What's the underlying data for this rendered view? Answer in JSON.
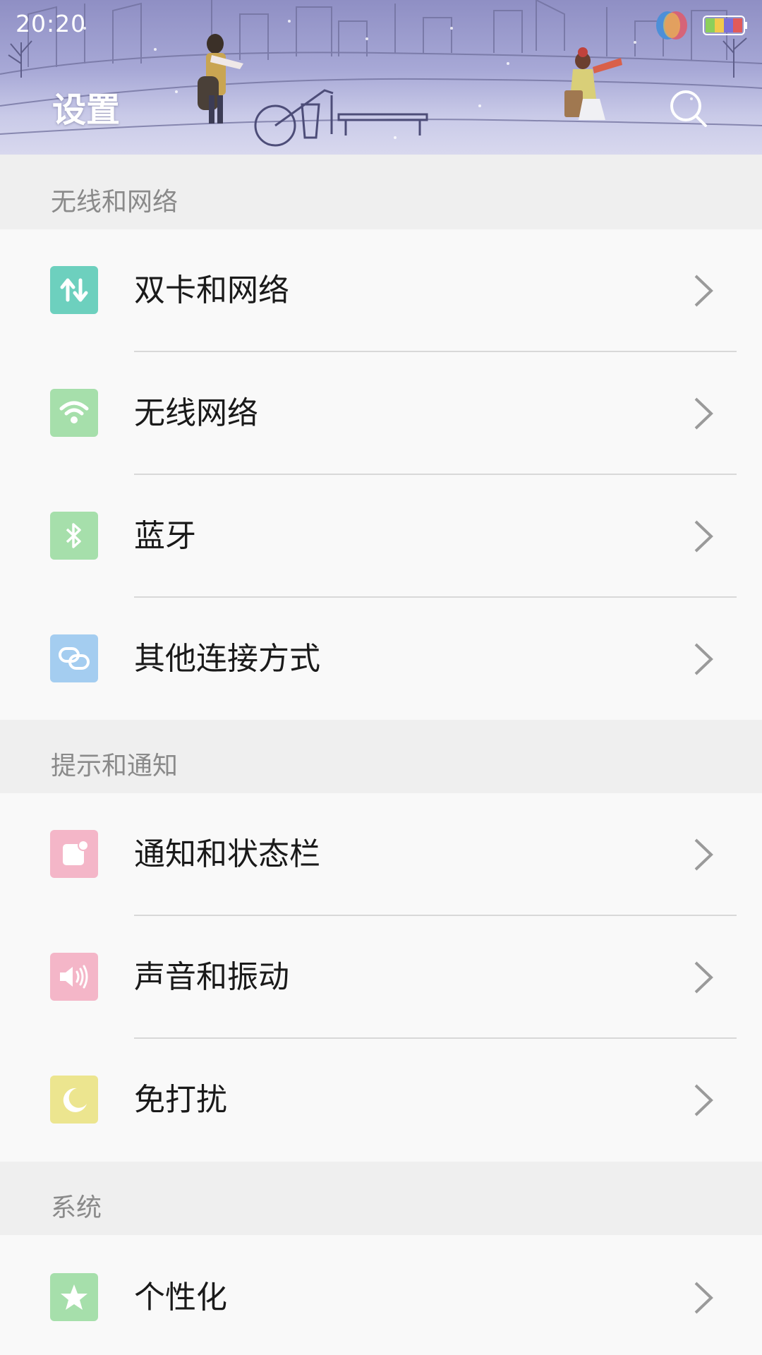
{
  "status_bar": {
    "time": "20:20"
  },
  "header": {
    "title": "设置"
  },
  "sections": [
    {
      "title": "无线和网络",
      "items": [
        {
          "label": "双卡和网络",
          "icon": "dual-sim-icon",
          "color": "#6dd0be"
        },
        {
          "label": "无线网络",
          "icon": "wifi-icon",
          "color": "#a6dfab"
        },
        {
          "label": "蓝牙",
          "icon": "bluetooth-icon",
          "color": "#a6dfab"
        },
        {
          "label": "其他连接方式",
          "icon": "link-icon",
          "color": "#a4cdf0"
        }
      ]
    },
    {
      "title": "提示和通知",
      "items": [
        {
          "label": "通知和状态栏",
          "icon": "notification-icon",
          "color": "#f4b6c8"
        },
        {
          "label": "声音和振动",
          "icon": "speaker-icon",
          "color": "#f4b6c8"
        },
        {
          "label": "免打扰",
          "icon": "moon-icon",
          "color": "#ece58f"
        }
      ]
    },
    {
      "title": "系统",
      "items": [
        {
          "label": "个性化",
          "icon": "star-icon",
          "color": "#a6dfab"
        }
      ]
    }
  ]
}
